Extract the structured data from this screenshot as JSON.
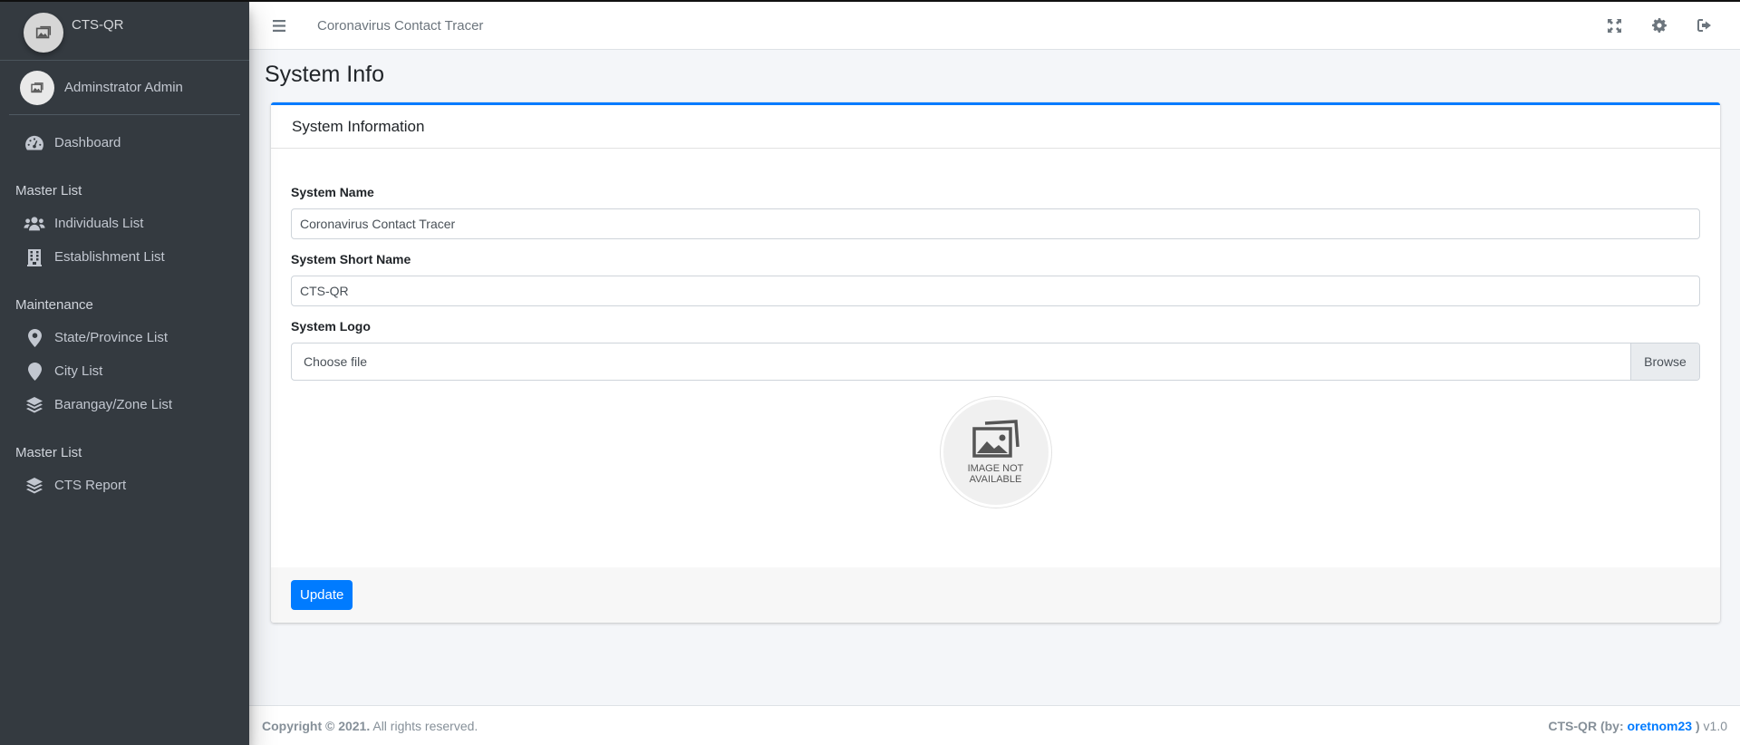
{
  "brand": {
    "name": "CTS-QR",
    "logo_icon": "image-not-available-icon"
  },
  "user": {
    "name": "Adminstrator Admin",
    "avatar_icon": "image-not-available-icon"
  },
  "sidebar": {
    "items": [
      {
        "type": "link",
        "label": "Dashboard",
        "icon": "tachometer-icon"
      },
      {
        "type": "header",
        "label": "Master List"
      },
      {
        "type": "link",
        "label": "Individuals List",
        "icon": "users-icon"
      },
      {
        "type": "link",
        "label": "Establishment List",
        "icon": "building-icon"
      },
      {
        "type": "header",
        "label": "Maintenance"
      },
      {
        "type": "link",
        "label": "State/Province List",
        "icon": "map-marker-icon"
      },
      {
        "type": "link",
        "label": "City List",
        "icon": "map-marker-icon"
      },
      {
        "type": "link",
        "label": "Barangay/Zone List",
        "icon": "layer-group-icon"
      },
      {
        "type": "header",
        "label": "Master List"
      },
      {
        "type": "link",
        "label": "CTS Report",
        "icon": "layer-group-icon"
      }
    ]
  },
  "topbar": {
    "title": "Coronavirus Contact Tracer",
    "icons": [
      "expand-icon",
      "gear-icon",
      "sign-out-icon"
    ]
  },
  "page": {
    "title": "System Info"
  },
  "card": {
    "header": "System Information",
    "fields": {
      "system_name": {
        "label": "System Name",
        "value": "Coronavirus Contact Tracer"
      },
      "system_short_name": {
        "label": "System Short Name",
        "value": "CTS-QR"
      },
      "system_logo": {
        "label": "System Logo",
        "placeholder": "Choose file",
        "browse_label": "Browse"
      }
    },
    "preview": {
      "line1": "IMAGE NOT",
      "line2": "AVAILABLE"
    },
    "update_label": "Update"
  },
  "footer": {
    "copyright_bold": "Copyright © 2021.",
    "copyright_rest": " All rights reserved.",
    "app_prefix": "CTS-QR (by: ",
    "author": "oretnom23",
    "app_suffix": " )",
    "version": " v1.0"
  },
  "colors": {
    "accent": "#007bff",
    "sidebar_bg": "#343a40"
  }
}
